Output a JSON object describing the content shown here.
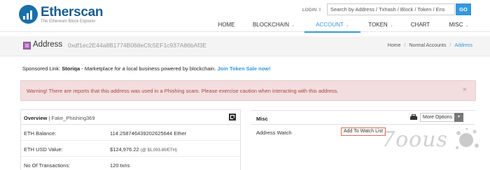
{
  "header": {
    "brand": "Etherscan",
    "tagline": "The Ethereum Block Explorer",
    "login": "LOGIN",
    "search_placeholder": "Search by Address / Txhash / Block / Token / Ens",
    "go_label": "GO",
    "nav": [
      {
        "label": "HOME",
        "has_caret": false,
        "active": false
      },
      {
        "label": "BLOCKCHAIN",
        "has_caret": true,
        "active": false
      },
      {
        "label": "ACCOUNT",
        "has_caret": true,
        "active": true
      },
      {
        "label": "TOKEN",
        "has_caret": true,
        "active": false
      },
      {
        "label": "CHART",
        "has_caret": false,
        "active": false
      },
      {
        "label": "MISC",
        "has_caret": true,
        "active": false
      }
    ],
    "accent": "#3498db"
  },
  "address_bar": {
    "title": "Address",
    "hash": "0xdf1ec2E44a8B1774B068eCfc5EF1c937A86bAf3E",
    "breadcrumb": [
      "Home",
      "Normal Accounts",
      "Address"
    ]
  },
  "sponsored": {
    "prefix": "Sponsored Link:",
    "name": "Storiqa",
    "text": "- Marketplace for a local business powered by blockchain.",
    "link": "Join Token Sale now!"
  },
  "warning": {
    "text": "Warning! There are reports that this address was used in a Phishing scam. Please exercise caution when interacting with this address.",
    "close": "×",
    "color": "#a94442"
  },
  "overview": {
    "title": "Overview",
    "label_tag": "Fake_Phishing369",
    "rows": [
      {
        "label": "ETH Balance:",
        "value": "114.258746439202625644 Ether",
        "note": ""
      },
      {
        "label": "ETH USD Value:",
        "value": "$124,976.22",
        "note": "(@ $1,093.80/ETH)"
      },
      {
        "label": "No Of Transactions:",
        "value": "120 txns",
        "note": ""
      }
    ]
  },
  "misc": {
    "title": "Misc",
    "more_options": "More Options",
    "address_watch_label": "Address Watch",
    "watch_button": "Add To Watch List"
  },
  "watermark": "7oous"
}
